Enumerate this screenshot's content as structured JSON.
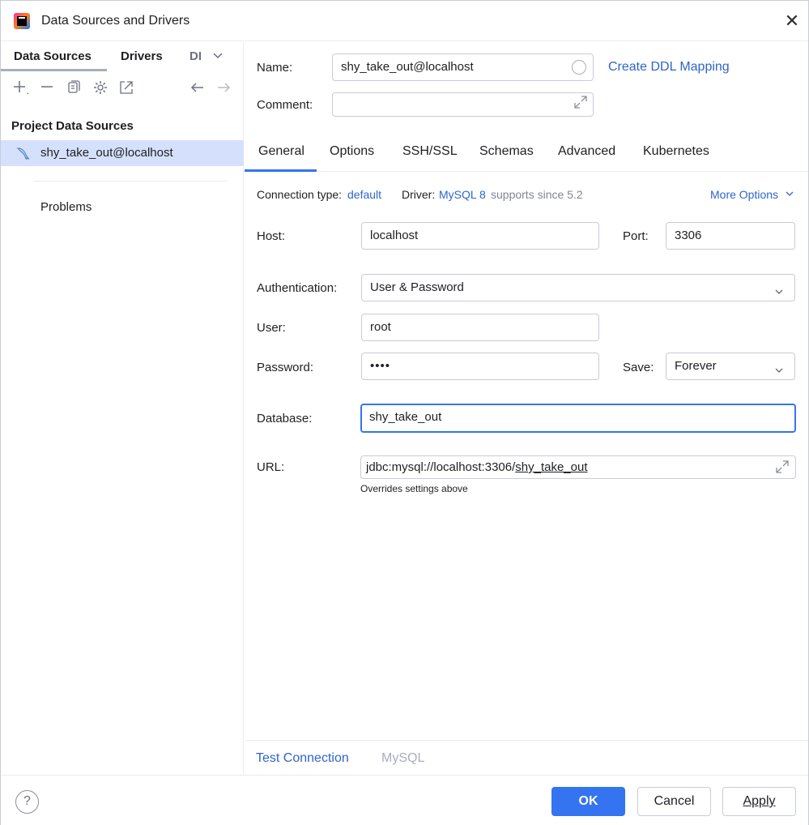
{
  "window": {
    "title": "Data Sources and Drivers"
  },
  "left": {
    "tabs": [
      "Data Sources",
      "Drivers",
      "DI"
    ],
    "section_title": "Project Data Sources",
    "data_source": "shy_take_out@localhost",
    "problems": "Problems"
  },
  "form": {
    "name_label": "Name:",
    "name_value": "shy_take_out@localhost",
    "create_ddl": "Create DDL Mapping",
    "comment_label": "Comment:",
    "comment_value": ""
  },
  "tabs": [
    "General",
    "Options",
    "SSH/SSL",
    "Schemas",
    "Advanced",
    "Kubernetes"
  ],
  "general": {
    "conn_type_label": "Connection type:",
    "conn_type_value": "default",
    "driver_label": "Driver:",
    "driver_value": "MySQL 8",
    "driver_note": "supports since 5.2",
    "more_options": "More Options",
    "host_label": "Host:",
    "host_value": "localhost",
    "port_label": "Port:",
    "port_value": "3306",
    "auth_label": "Authentication:",
    "auth_value": "User & Password",
    "user_label": "User:",
    "user_value": "root",
    "password_label": "Password:",
    "password_value": "••••",
    "save_label": "Save:",
    "save_value": "Forever",
    "database_label": "Database:",
    "database_value": "shy_take_out",
    "url_label": "URL:",
    "url_prefix": "jdbc:mysql://localhost:3306/",
    "url_db": "shy_take_out",
    "url_note": "Overrides settings above"
  },
  "bottom": {
    "test_connection": "Test Connection",
    "driver_name": "MySQL"
  },
  "footer": {
    "help": "?",
    "ok": "OK",
    "cancel": "Cancel",
    "apply": "Apply"
  }
}
